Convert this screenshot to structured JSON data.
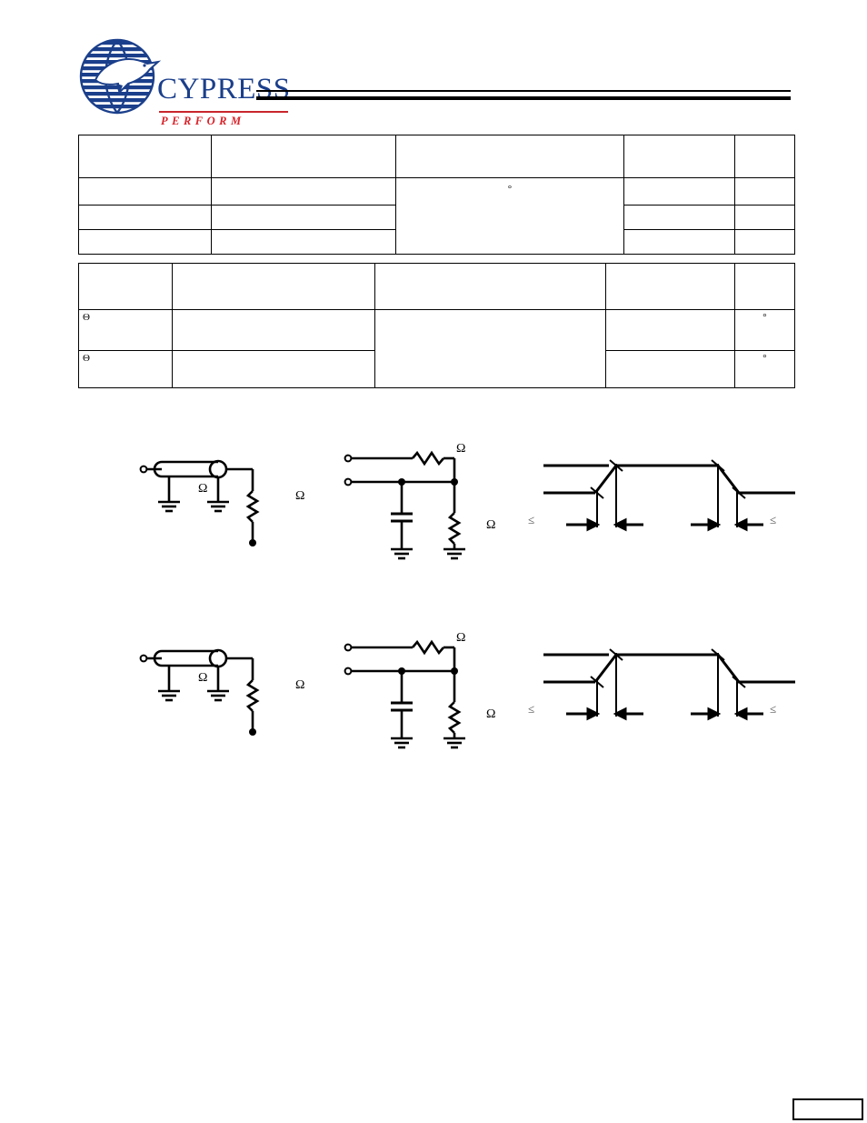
{
  "document": {
    "title": "",
    "page_number": ""
  },
  "logo": {
    "wordmark": "CYPRESS",
    "tagline": "PERFORM",
    "brand_blue": "#1b3f8b",
    "brand_red": "#d8232a",
    "globe_icon": "cypress-globe-icon"
  },
  "tables": [
    {
      "id": "thermal-resistance-table-1",
      "columns": [
        "",
        "",
        "",
        "",
        ""
      ],
      "rows": [
        {
          "cells": [
            "",
            "",
            "",
            "",
            ""
          ]
        },
        {
          "cells": [
            "",
            "",
            "°",
            "",
            ""
          ]
        },
        {
          "cells": [
            "",
            "",
            "",
            "",
            ""
          ]
        },
        {
          "cells": [
            "",
            "",
            "",
            "",
            ""
          ]
        }
      ]
    },
    {
      "id": "thermal-resistance-table-2",
      "columns": [
        "",
        "",
        "",
        "",
        ""
      ],
      "rows": [
        {
          "cells": [
            "",
            "",
            "",
            "",
            ""
          ]
        },
        {
          "cells": [
            "Θ",
            "",
            "",
            "",
            "°"
          ]
        },
        {
          "cells": [
            "Θ",
            "",
            "",
            "",
            "°"
          ]
        }
      ]
    }
  ],
  "figures": [
    {
      "id": "ac-test-loads-waveforms-1",
      "test_load": {
        "label": "ac-test-load-transmission-line",
        "ohm_symbols": [
          "Ω",
          "Ω"
        ]
      },
      "equivalent_circuit": {
        "label": "equivalent-to-thevenin-equivalent",
        "ohm_symbols": [
          "Ω",
          "Ω"
        ]
      },
      "waveform": {
        "label": "ac-test-waveform-rise-fall",
        "annotations": [
          "≤",
          "≤"
        ]
      }
    },
    {
      "id": "ac-test-loads-waveforms-2",
      "test_load": {
        "label": "ac-test-load-transmission-line",
        "ohm_symbols": [
          "Ω",
          "Ω"
        ]
      },
      "equivalent_circuit": {
        "label": "equivalent-to-thevenin-equivalent",
        "ohm_symbols": [
          "Ω",
          "Ω"
        ]
      },
      "waveform": {
        "label": "ac-test-waveform-rise-fall",
        "annotations": [
          "≤",
          "≤"
        ]
      }
    }
  ]
}
